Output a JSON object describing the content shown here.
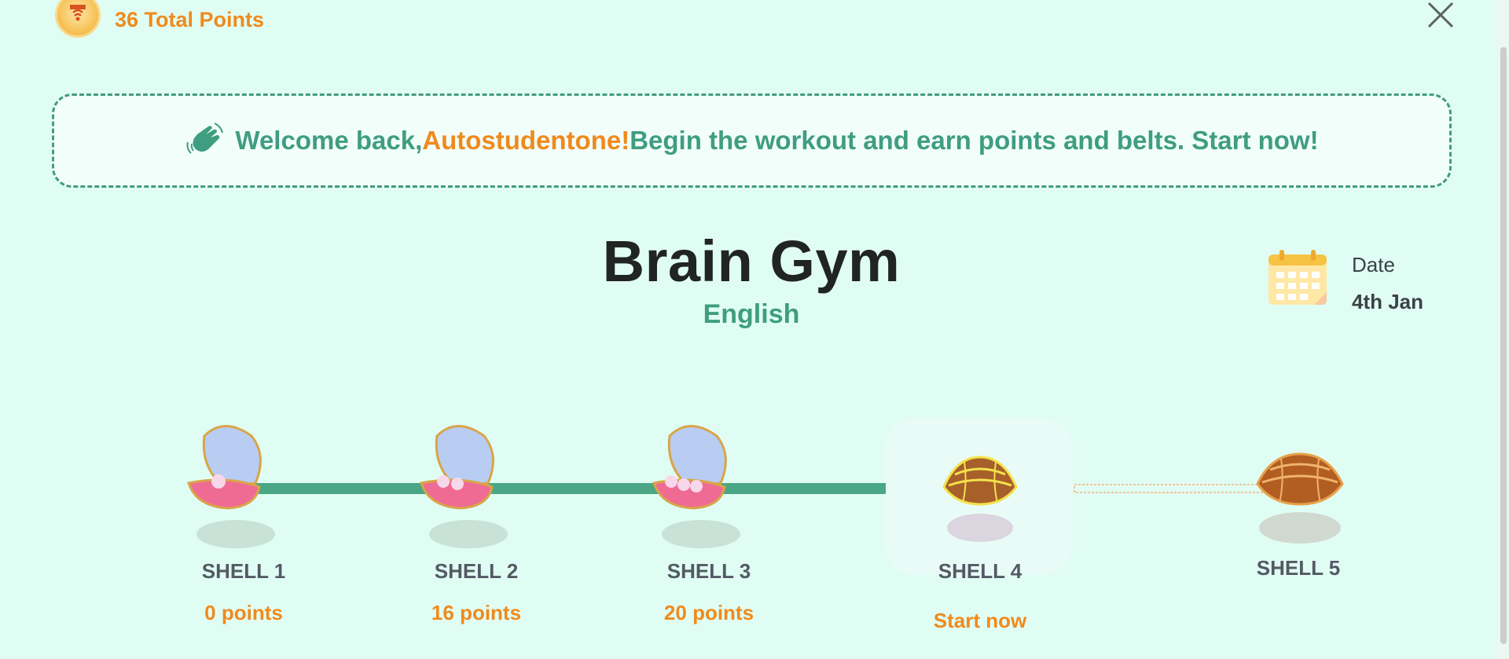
{
  "header": {
    "points_text": "36 Total Points",
    "badge_icon": "medal-icon"
  },
  "close_icon": "close-icon",
  "welcome": {
    "prefix": "Welcome back, ",
    "name": "Autostudentone!",
    "suffix": " Begin the workout and earn points and belts. Start now!",
    "icon": "waving-hand-icon"
  },
  "main": {
    "title": "Brain Gym",
    "subject": "English"
  },
  "date": {
    "label": "Date",
    "value": "4th Jan",
    "icon": "calendar-icon"
  },
  "shells": [
    {
      "name": "SHELL 1",
      "status": "0 points",
      "state": "open",
      "pearls": 1
    },
    {
      "name": "SHELL 2",
      "status": "16 points",
      "state": "open",
      "pearls": 2
    },
    {
      "name": "SHELL 3",
      "status": "20 points",
      "state": "open",
      "pearls": 3
    },
    {
      "name": "SHELL 4",
      "status": "Start now",
      "state": "closed-active"
    },
    {
      "name": "SHELL 5",
      "status": "",
      "state": "closed-locked"
    }
  ],
  "colors": {
    "accent_green": "#3f9d80",
    "accent_orange": "#f08a1c",
    "background": "#e0fdf3"
  }
}
